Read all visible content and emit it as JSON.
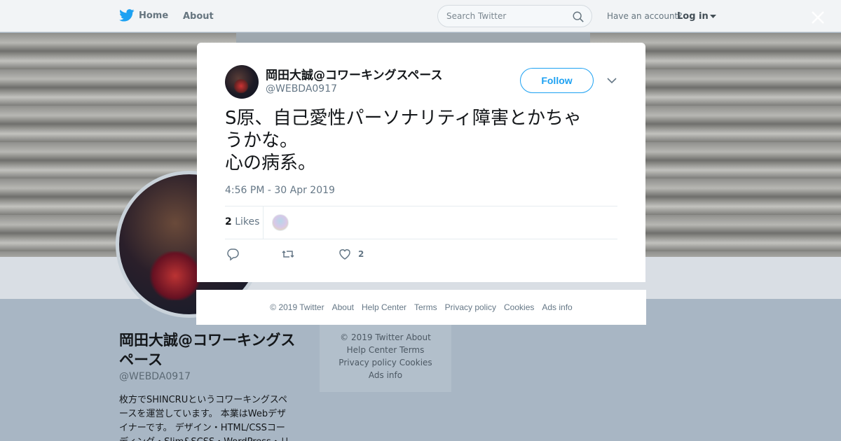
{
  "topbar": {
    "home_label": "Home",
    "about_label": "About",
    "search_placeholder": "Search Twitter",
    "have_account": "Have an account?",
    "login_label": "Log in"
  },
  "profile": {
    "name": "岡田大誠@コワーキングスペース",
    "handle": "@WEBDA0917",
    "bio_lines": [
      "枚方でSHINCRUというコワーキングスペ",
      "ースを運営しています。 本業はWebデザ",
      "イナーです。 デザイン・HTML/CSSコー",
      "ディング・Slim&SCSS・WordPress・リ"
    ]
  },
  "bg_footer": {
    "lines": [
      "© 2019 Twitter   About",
      "Help Center   Terms",
      "Privacy policy   Cookies",
      "Ads info"
    ]
  },
  "tweet": {
    "author_name": "岡田大誠@コワーキングスペース",
    "author_handle": "@WEBDA0917",
    "follow_label": "Follow",
    "text": "S原、自己愛性パーソナリティ障害とかちゃ\nうかな。\n心の病系。",
    "timestamp": "4:56 PM - 30 Apr 2019",
    "likes_count": "2",
    "likes_label": "Likes",
    "action_like_count": "2"
  },
  "footer": {
    "links": [
      "© 2019 Twitter",
      "About",
      "Help Center",
      "Terms",
      "Privacy policy",
      "Cookies",
      "Ads info"
    ]
  },
  "colors": {
    "twitter_blue": "#1da1f2",
    "overlay": "#a8b6c4",
    "muted_text": "#657786"
  },
  "icons": [
    "twitter-bird-icon",
    "search-icon",
    "caret-down-icon",
    "close-icon",
    "chevron-down-icon",
    "reply-icon",
    "retweet-icon",
    "heart-icon"
  ]
}
